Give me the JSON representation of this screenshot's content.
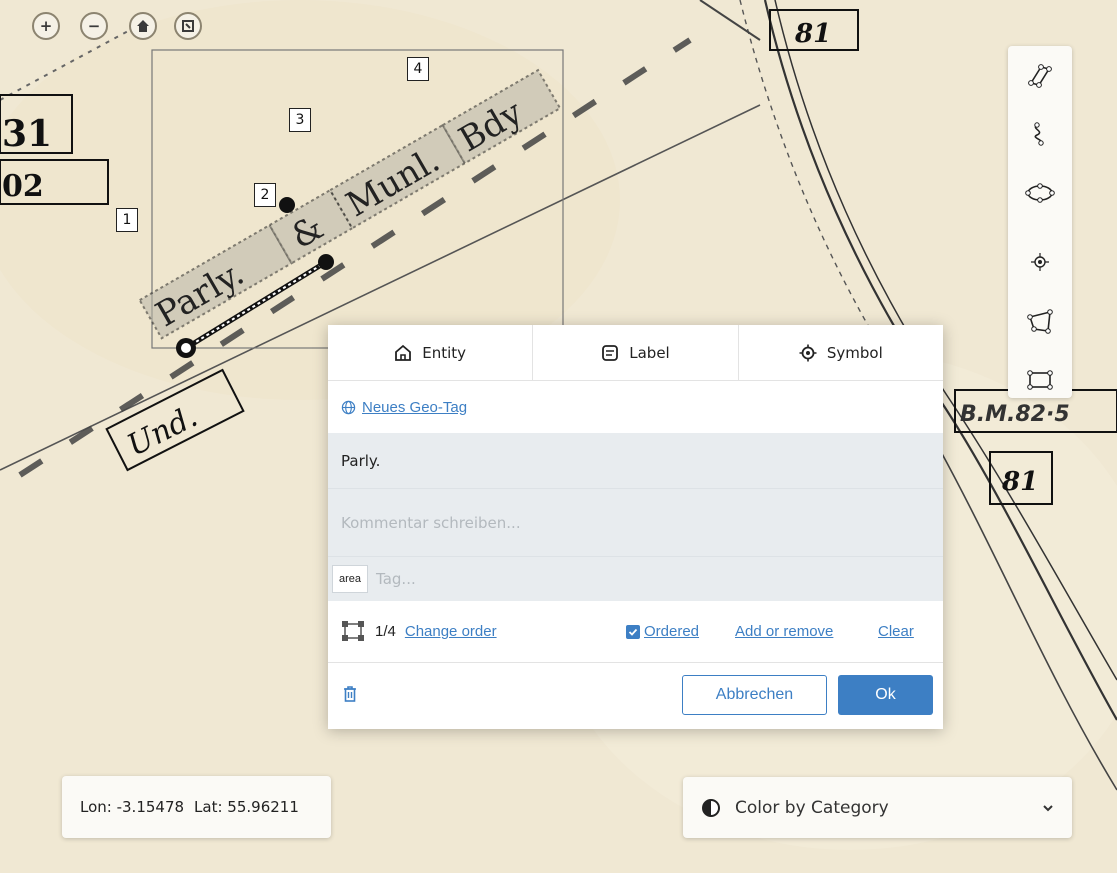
{
  "map": {
    "controls": [
      "zoom-in-icon",
      "zoom-out-icon",
      "home-icon",
      "fullscreen-icon"
    ],
    "map_text": {
      "m81_top": "81",
      "m31": "31",
      "m02": "02",
      "und": "Und.",
      "bm": "B.M.82·5",
      "m81_right": "81",
      "parly": "Parly.",
      "amp": "&",
      "munl": "Munl.",
      "bdy": "Bdy"
    },
    "point_numbers": [
      "1",
      "2",
      "3",
      "4"
    ]
  },
  "toolbar": {
    "tools": [
      "line-tool-icon",
      "freehand-tool-icon",
      "ellipse-tool-icon",
      "point-tool-icon",
      "polygon-tool-icon",
      "rectangle-tool-icon"
    ]
  },
  "popup": {
    "tabs": [
      {
        "label": "Entity",
        "icon": "home-icon"
      },
      {
        "label": "Label",
        "icon": "label-icon"
      },
      {
        "label": "Symbol",
        "icon": "target-icon"
      }
    ],
    "geo_tag_link": "Neues Geo-Tag",
    "transcription": "Parly.",
    "comment_placeholder": "Kommentar schreiben...",
    "tag_chip": "area",
    "tag_placeholder": "Tag...",
    "order_count": "1/4",
    "change_order": "Change order",
    "ordered_label": "Ordered",
    "ordered_checked": true,
    "add_or_remove": "Add or remove",
    "clear": "Clear",
    "cancel": "Abbrechen",
    "ok": "Ok",
    "accent": "#3d7fc4"
  },
  "coords": {
    "lon_label": "Lon: -3.15478",
    "lat_label": "Lat: 55.96211"
  },
  "color_select": {
    "label": "Color by Category"
  }
}
